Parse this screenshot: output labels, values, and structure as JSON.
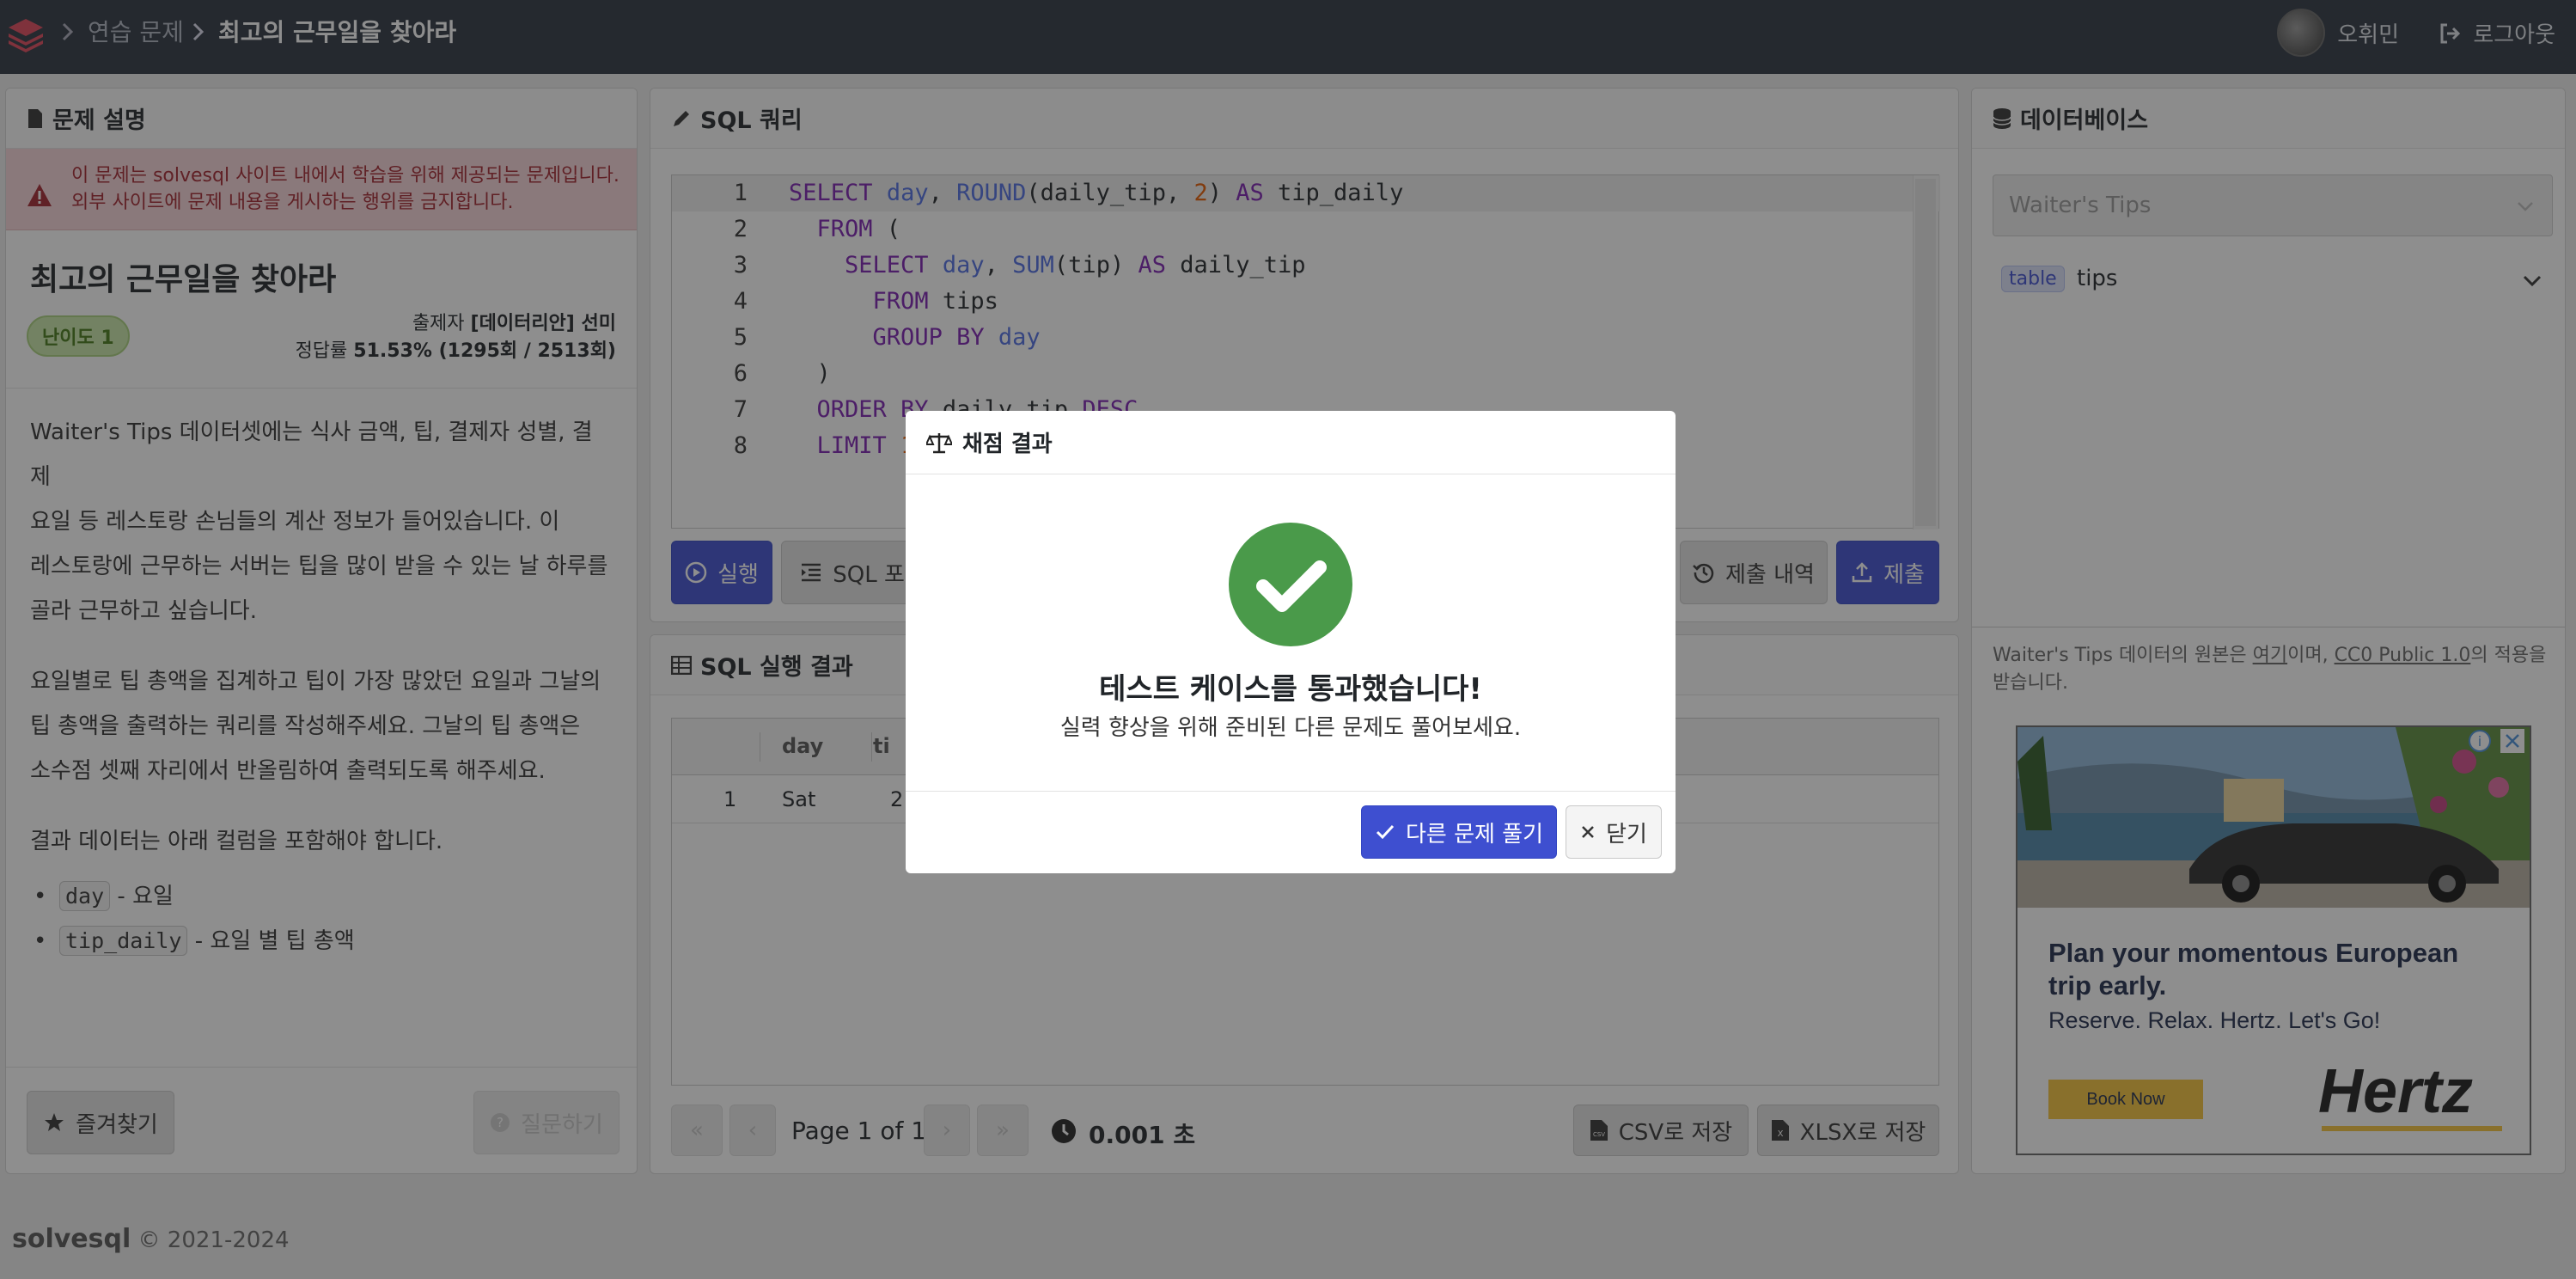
{
  "topbar": {
    "breadcrumb": [
      "연습 문제",
      "최고의 근무일을 찾아라"
    ],
    "user_name": "오휘민",
    "logout_label": "로그아웃"
  },
  "problem_panel": {
    "header": "문제 설명",
    "warning_line1": "이 문제는 solvesql 사이트 내에서 학습을 위해 제공되는 문제입니다.",
    "warning_line2": "외부 사이트에 문제 내용을 게시하는 행위를 금지합니다.",
    "title": "최고의 근무일을 찾아라",
    "difficulty": "난이도 1",
    "author_label": "출제자",
    "author": "[데이터리안] 선미",
    "accuracy_label": "정답률",
    "accuracy": "51.53% (1295회 / 2513회)",
    "desc_lines": [
      "Waiter's Tips 데이터셋에는 식사 금액, 팁, 결제자 성별, 결제",
      "요일 등 레스토랑 손님들의 계산 정보가 들어있습니다. 이",
      "레스토랑에 근무하는 서버는 팁을 많이 받을 수 있는 날 하루를",
      "골라 근무하고 싶습니다."
    ],
    "desc_lines2": [
      "요일별로 팁 총액을 집계하고 팁이 가장 많았던 요일과 그날의",
      "팁 총액을 출력하는 쿼리를 작성해주세요. 그날의 팁 총액은",
      "소수점 셋째 자리에서 반올림하여 출력되도록 해주세요."
    ],
    "result_intro": "결과 데이터는 아래 컬럼을 포함해야 합니다.",
    "columns": [
      {
        "name": "day",
        "desc": "- 요일"
      },
      {
        "name": "tip_daily",
        "desc": "- 요일 별 팁 총액"
      }
    ],
    "favorite_label": "즐겨찾기",
    "ask_label": "질문하기"
  },
  "sql_panel": {
    "header": "SQL 쿼리",
    "run_label": "실행",
    "format_label": "SQL 포맷",
    "history_label": "제출 내역",
    "submit_label": "제출"
  },
  "result_panel": {
    "header": "SQL 실행 결과",
    "col_day": "day",
    "col_tip": "ti",
    "row_num": "1",
    "row_day": "Sat",
    "row_tip": "2",
    "page_info": "Page 1 of 1",
    "exec_time": "0.001 초",
    "csv_label": "CSV로 저장",
    "xlsx_label": "XLSX로 저장"
  },
  "db_panel": {
    "header": "데이터베이스",
    "select_value": "Waiter's Tips",
    "table_tag": "table",
    "table_name": "tips",
    "source_prefix": "Waiter's Tips 데이터의 원본은 ",
    "source_link": "여기",
    "source_mid": "이며, ",
    "license_link": "CC0 Public 1.0",
    "source_suffix": "의 적용을",
    "source_line2": "받습니다."
  },
  "ad": {
    "headline_line1": "Plan your momentous European",
    "headline_line2": "trip early.",
    "tagline": "Reserve. Relax. Hertz. Let's Go!",
    "cta": "Book Now",
    "brand": "Hertz"
  },
  "modal": {
    "title": "채점 결과",
    "message": "테스트 케이스를 통과했습니다!",
    "sub_message": "실력 향상을 위해 준비된 다른 문제도 풀어보세요.",
    "next_label": "다른 문제 풀기",
    "close_label": "닫기"
  },
  "footer": {
    "brand": "solvesql",
    "copyright": "© 2021-2024"
  },
  "colors": {
    "topbar": "#2c3440",
    "primary": "#3e4fd0",
    "success": "#4a9a4a",
    "warning_bg": "#f6d5d8"
  }
}
